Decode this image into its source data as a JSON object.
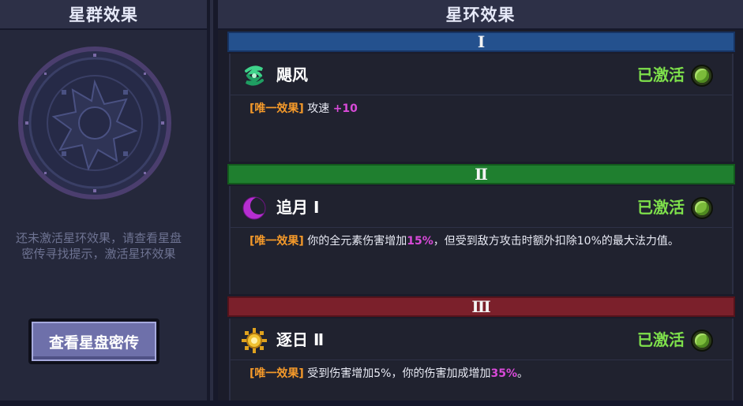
{
  "left_panel": {
    "title": "星群效果",
    "hint_line1": "还未激活星环效果，请查看星盘",
    "hint_line2": "密传寻找提示，激活星环效果",
    "button_label": "查看星盘密传"
  },
  "right_panel": {
    "title": "星环效果",
    "tiers": [
      {
        "numeral": "Ⅰ",
        "color": "#24518e",
        "skill_name": "飓风",
        "icon": "cyclone-icon",
        "status": "已激活",
        "tag": "[唯一效果]",
        "desc_before": " 攻速 ",
        "desc_highlight": "+10",
        "desc_after": ""
      },
      {
        "numeral": "Ⅱ",
        "color": "#1f7f2f",
        "skill_name": "追月 Ⅰ",
        "icon": "crescent-moon-icon",
        "status": "已激活",
        "tag": "[唯一效果]",
        "desc_before": " 你的全元素伤害增加",
        "desc_highlight": "15%",
        "desc_after": "，但受到敌方攻击时额外扣除10%的最大法力值。"
      },
      {
        "numeral": "Ⅲ",
        "color": "#7b202b",
        "skill_name": "逐日 Ⅱ",
        "icon": "sun-icon",
        "status": "已激活",
        "tag": "[唯一效果]",
        "desc_before": " 受到伤害增加5%，你的伤害加成增加",
        "desc_highlight": "35%",
        "desc_after": "。"
      }
    ]
  },
  "colors": {
    "status_green": "#7ee04b",
    "tag_orange": "#f59a2a",
    "highlight_magenta": "#d84ad8"
  }
}
